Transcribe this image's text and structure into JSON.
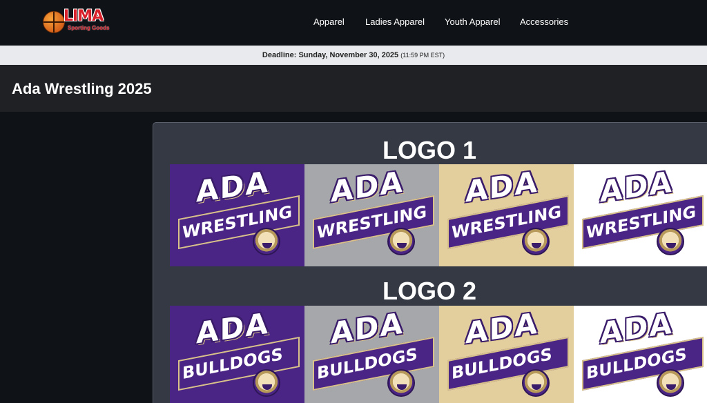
{
  "brand": {
    "name": "LIMA",
    "tagline": "Sporting Goods"
  },
  "nav": {
    "items": [
      "Apparel",
      "Ladies Apparel",
      "Youth Apparel",
      "Accessories"
    ]
  },
  "deadline": {
    "label": "Deadline:",
    "date": "Sunday, November 30, 2025",
    "time": "(11:59 PM EST)"
  },
  "page": {
    "title": "Ada Wrestling 2025"
  },
  "logos": [
    {
      "heading": "LOGO 1",
      "line1": "ADA",
      "line2": "WRESTLING",
      "variants": [
        {
          "bg": "purple"
        },
        {
          "bg": "grey"
        },
        {
          "bg": "gold"
        },
        {
          "bg": "white"
        }
      ]
    },
    {
      "heading": "LOGO 2",
      "line1": "ADA",
      "line2": "BULLDOGS",
      "variants": [
        {
          "bg": "purple"
        },
        {
          "bg": "grey"
        },
        {
          "bg": "gold"
        },
        {
          "bg": "white"
        }
      ]
    }
  ],
  "colors": {
    "purple": "#4b2585",
    "grey": "#a6a7aa",
    "gold": "#e3cf9e",
    "white": "#ffffff",
    "accent_red": "#d8202a"
  },
  "icons": {
    "logo": "basketball-icon",
    "mascot": "bulldog-icon"
  }
}
